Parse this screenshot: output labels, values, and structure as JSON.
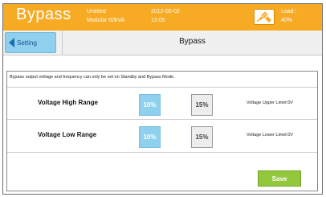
{
  "header": {
    "app_title": "Bypass",
    "device_name": "Untitled",
    "device_model": "Modular 60kVA",
    "date": "2012-09-02",
    "time": "13:05",
    "load_label": "Load :",
    "load_value": "40%",
    "load_icon": "power-plug-icon"
  },
  "nav": {
    "back_label": "Setting",
    "page_title": "Bypass"
  },
  "content": {
    "info": "Bypass output voltage and frequency can only be set on Standby and Bypass Mode.",
    "high_range": {
      "label": "Voltage High Range",
      "options": [
        "10%",
        "15%"
      ],
      "selected": "10%",
      "limit": "Voltage Upper Limet:0V"
    },
    "low_range": {
      "label": "Voltage Low Range",
      "options": [
        "10%",
        "15%"
      ],
      "selected": "10%",
      "limit": "Voltage Lower Limet:0V"
    },
    "save_label": "Save"
  },
  "colors": {
    "header": "#f7ab24",
    "selected_option": "#8fd0ee",
    "save": "#93c83c"
  }
}
